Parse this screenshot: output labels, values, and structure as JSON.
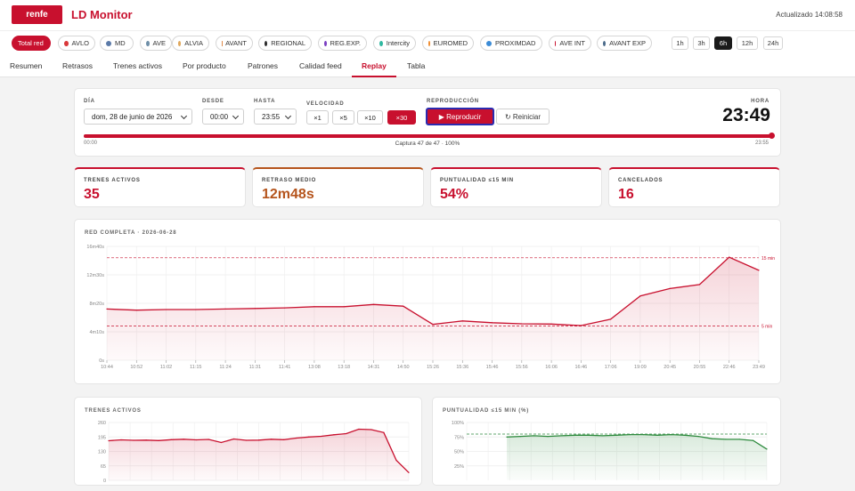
{
  "header": {
    "logo": "renfe",
    "title": "LD Monitor",
    "updated": "Actualizado 14:08:58"
  },
  "filters": [
    {
      "label": "Total red",
      "color": "",
      "active": true
    },
    {
      "label": "AVLO",
      "color": "#d9383a"
    },
    {
      "label": "MD",
      "color": "#5b7aa8"
    },
    {
      "label": "AVE",
      "color": "#6f8fa8"
    },
    {
      "label": "ALVIA",
      "color": "#e0a85c"
    },
    {
      "label": "AVANT",
      "color": "#e08a4a"
    },
    {
      "label": "REGIONAL",
      "color": "#2b2b2b"
    },
    {
      "label": "REG.EXP.",
      "color": "#7b3fc2"
    },
    {
      "label": "Intercity",
      "color": "#2fb8a0"
    },
    {
      "label": "EUROMED",
      "color": "#f08a2a"
    },
    {
      "label": "PROXIMDAD",
      "color": "#3b8bd6"
    },
    {
      "label": "AVE INT",
      "color": "#c8102e"
    },
    {
      "label": "AVANT EXP",
      "color": "#4a6a8a"
    }
  ],
  "hours": [
    {
      "label": "1h"
    },
    {
      "label": "3h"
    },
    {
      "label": "6h",
      "active": true
    },
    {
      "label": "12h"
    },
    {
      "label": "24h"
    }
  ],
  "tabs": [
    {
      "label": "Resumen"
    },
    {
      "label": "Retrasos"
    },
    {
      "label": "Trenes activos"
    },
    {
      "label": "Por producto"
    },
    {
      "label": "Patrones"
    },
    {
      "label": "Calidad feed"
    },
    {
      "label": "Replay",
      "active": true
    },
    {
      "label": "Tabla"
    }
  ],
  "replay": {
    "day_label": "DÍA",
    "day_value": "dom, 28 de junio de 2026",
    "from_label": "DESDE",
    "from_value": "00:00",
    "to_label": "HASTA",
    "to_value": "23:55",
    "speed_label": "VELOCIDAD",
    "speeds": [
      "×1",
      "×5",
      "×10",
      "×30"
    ],
    "speed_active": 3,
    "playback_label": "REPRODUCCIÓN",
    "play": "▶ Reproducir",
    "reset": "↻ Reiniciar",
    "clock_label": "HORA",
    "clock": "23:49",
    "progress": 1.0,
    "start": "00:00",
    "end": "23:55",
    "capture": "Captura 47 de 47 · 100%"
  },
  "kpis": [
    {
      "label": "TRENES ACTIVOS",
      "value": "35",
      "color": "#c8102e"
    },
    {
      "label": "RETRASO MEDIO",
      "value": "12m48s",
      "color": "#b5541c"
    },
    {
      "label": "PUNTUALIDAD ≤15 MIN",
      "value": "54%",
      "color": "#c8102e"
    },
    {
      "label": "CANCELADOS",
      "value": "16",
      "color": "#c8102e"
    }
  ],
  "chart_data": [
    {
      "type": "area",
      "title": "RED COMPLETA · 2026-06-28",
      "y_ticks": [
        "0s",
        "4m10s",
        "8m20s",
        "12m30s",
        "16m40s"
      ],
      "ylim": [
        0,
        1000
      ],
      "x": [
        "10:44",
        "10:52",
        "11:02",
        "11:15",
        "11:24",
        "11:31",
        "11:41",
        "13:08",
        "13:18",
        "14:31",
        "14:50",
        "15:26",
        "15:36",
        "15:46",
        "15:56",
        "16:06",
        "16:46",
        "17:06",
        "19:09",
        "20:45",
        "20:55",
        "22:46",
        "23:49"
      ],
      "x_ticks": [
        "10:44",
        "10:52",
        "11:02",
        "11:15",
        "11:24",
        "11:31",
        "11:41",
        "13:08",
        "13:18",
        "14:31",
        "14:50",
        "15:26",
        "15:36",
        "15:46",
        "15:56",
        "16:06",
        "16:46",
        "17:06",
        "19:09",
        "20:45",
        "20:55",
        "22:46",
        "23:49"
      ],
      "values": [
        450,
        440,
        445,
        445,
        450,
        455,
        460,
        470,
        470,
        490,
        475,
        315,
        345,
        330,
        320,
        318,
        305,
        360,
        565,
        630,
        665,
        905,
        790
      ],
      "ref_lines": [
        {
          "value": 900,
          "label": "15 min"
        },
        {
          "value": 300,
          "label": "5 min"
        }
      ],
      "color": "#c8102e"
    },
    {
      "type": "area",
      "title": "TRENES ACTIVOS",
      "y_ticks": [
        "0",
        "65",
        "130",
        "195",
        "260"
      ],
      "ylim": [
        0,
        260
      ],
      "values": [
        178,
        182,
        180,
        181,
        179,
        183,
        185,
        182,
        184,
        170,
        186,
        180,
        181,
        185,
        183,
        190,
        195,
        198,
        205,
        210,
        230,
        228,
        215,
        90,
        35
      ],
      "color": "#c8102e"
    },
    {
      "type": "area",
      "title": "PUNTUALIDAD ≤15 MIN (%)",
      "y_ticks": [
        "25%",
        "50%",
        "75%",
        "100%"
      ],
      "ylim": [
        0,
        100
      ],
      "values": [
        75,
        76,
        77,
        76,
        77,
        78,
        78,
        77,
        78,
        79,
        79,
        78,
        79,
        78,
        76,
        72,
        71,
        71,
        69,
        54
      ],
      "ref_value": 80,
      "color": "#2e8b3e"
    }
  ]
}
